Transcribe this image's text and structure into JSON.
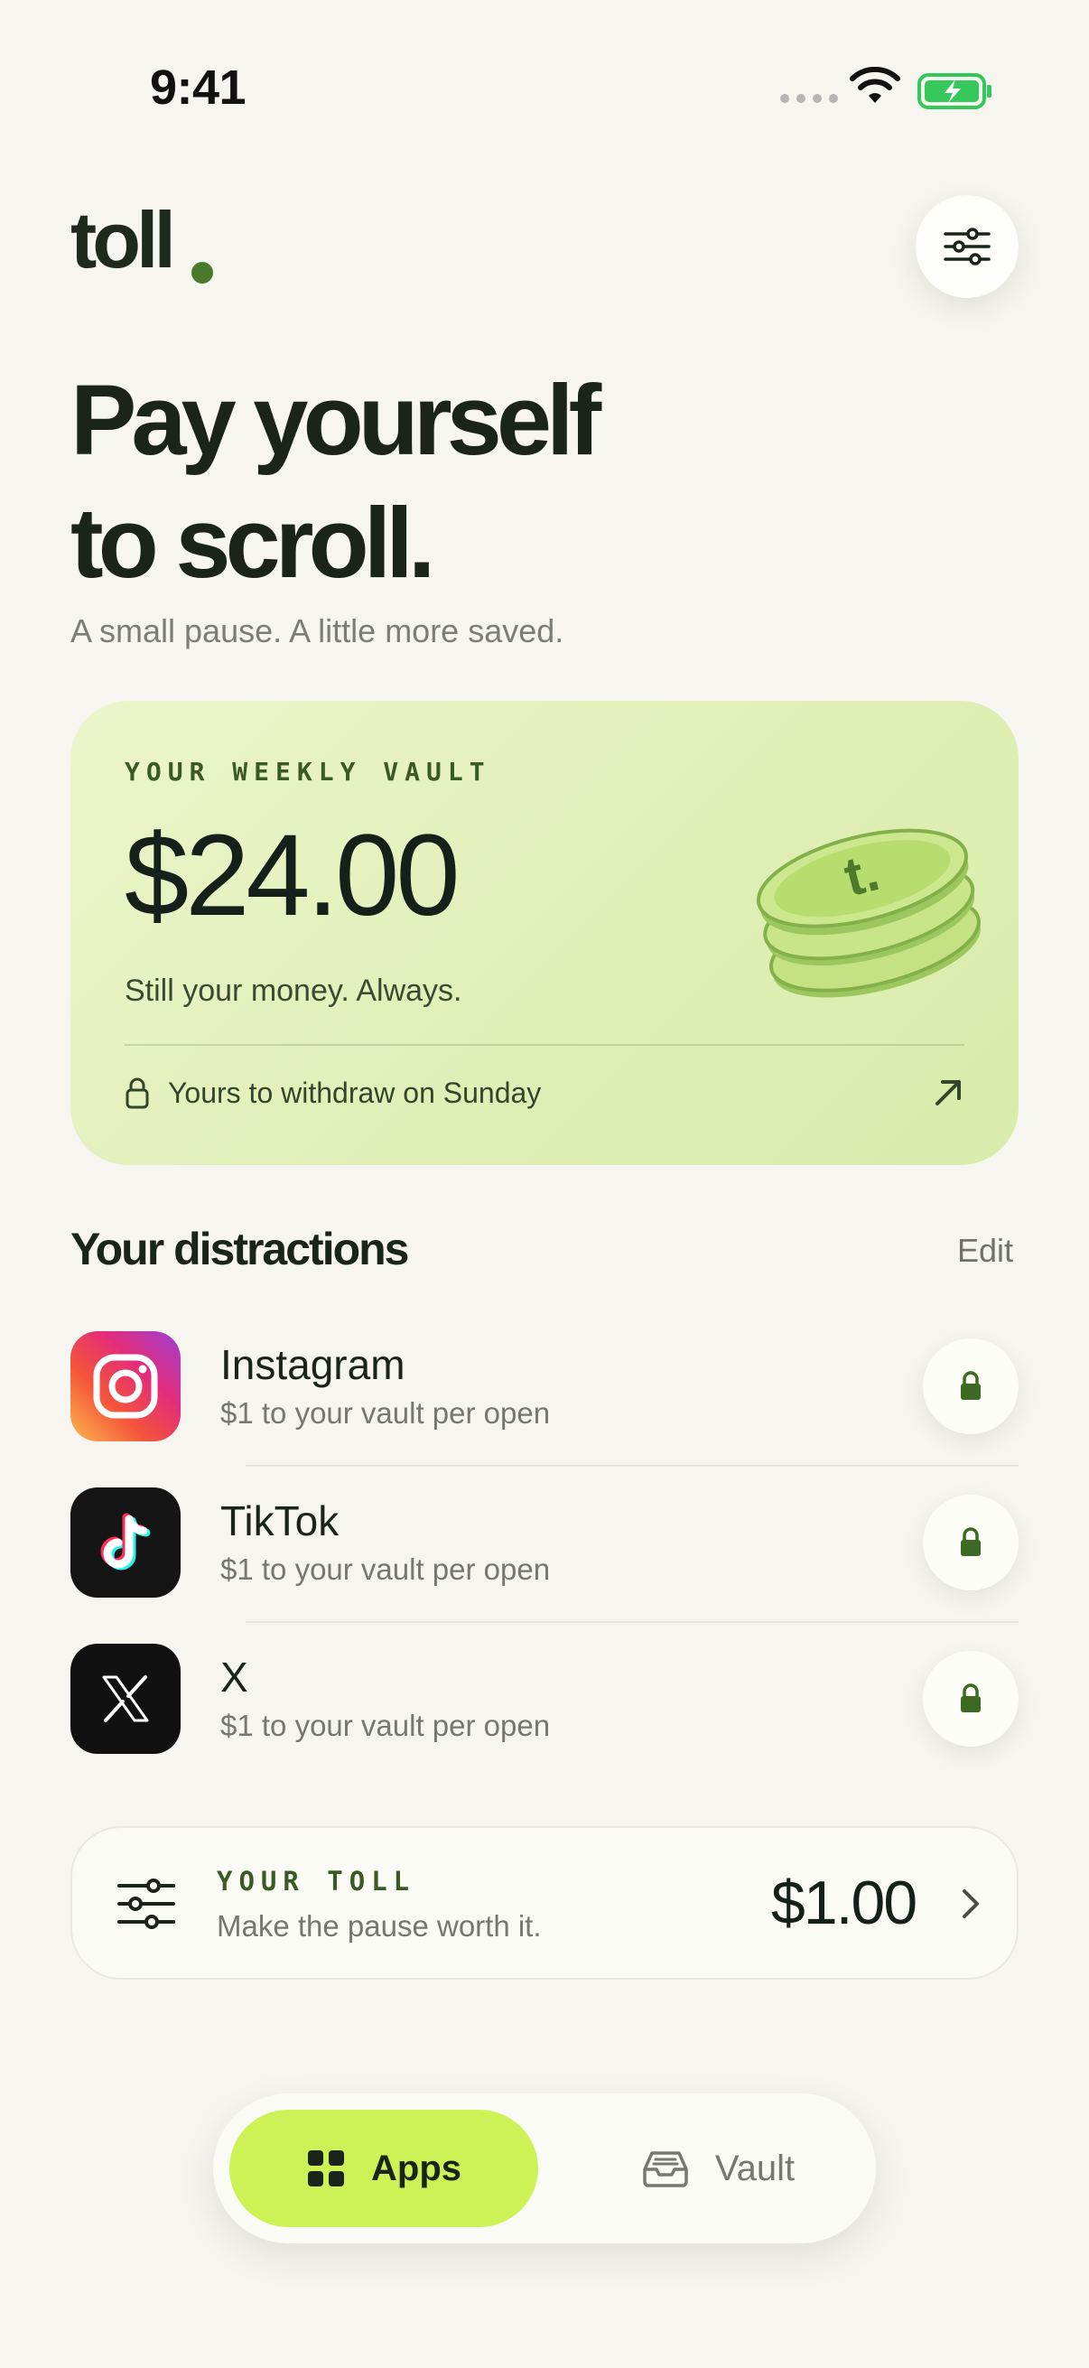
{
  "status_bar": {
    "time": "9:41"
  },
  "brand": {
    "logo_text": "toll"
  },
  "hero": {
    "headline_line1": "Pay yourself",
    "headline_line2": "to scroll.",
    "subtitle": "A small pause. A little more saved."
  },
  "vault_card": {
    "label": "YOUR WEEKLY VAULT",
    "amount": "$24.00",
    "tagline": "Still your money. Always.",
    "withdraw_text": "Yours to withdraw on Sunday",
    "coin_letter": "t."
  },
  "distractions": {
    "title": "Your distractions",
    "edit_label": "Edit",
    "apps": [
      {
        "name": "Instagram",
        "subtitle": "$1 to your vault per open",
        "icon": "instagram-icon"
      },
      {
        "name": "TikTok",
        "subtitle": "$1 to your vault per open",
        "icon": "tiktok-icon"
      },
      {
        "name": "X",
        "subtitle": "$1 to your vault per open",
        "icon": "x-icon"
      }
    ]
  },
  "toll_card": {
    "label": "YOUR TOLL",
    "subtitle": "Make the pause worth it.",
    "amount": "$1.00"
  },
  "tab_bar": {
    "tabs": [
      {
        "label": "Apps",
        "icon": "grid-icon",
        "active": true
      },
      {
        "label": "Vault",
        "icon": "tray-icon",
        "active": false
      }
    ]
  },
  "colors": {
    "background": "#f6f5ef",
    "accent_lime": "#cdf256",
    "vault_green": "#3a5a25",
    "text_dark": "#1b2419"
  }
}
